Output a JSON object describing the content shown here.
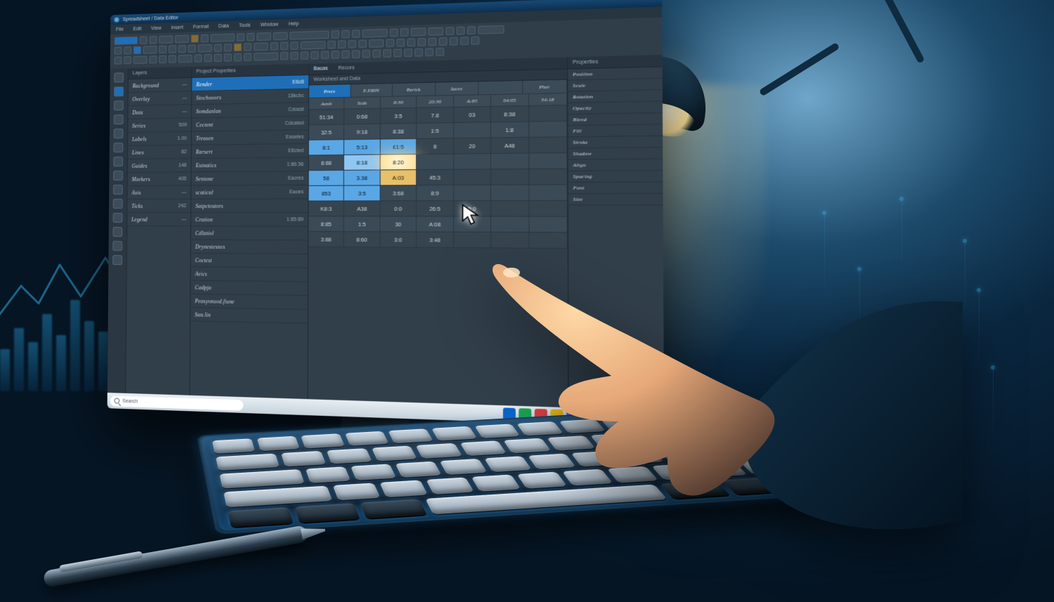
{
  "scene_description": "Stylized 3D render of a desk at night: a monitor showing a dark spreadsheet/data application, a backlit keyboard, a pen, and a desk lamp. A hand reaches toward the screen where a mouse cursor hovers over highlighted cells.",
  "app": {
    "title": "Spreadsheet / Data Editor",
    "menubar": [
      "File",
      "Edit",
      "View",
      "Insert",
      "Format",
      "Data",
      "Tools",
      "Window",
      "Help"
    ],
    "left_tool_count": 14,
    "panel_left": {
      "header": "Layers",
      "items": [
        {
          "label": "Background",
          "value": "—"
        },
        {
          "label": "Overlay",
          "value": "—"
        },
        {
          "label": "Data",
          "value": "—"
        },
        {
          "label": "Series",
          "value": "509"
        },
        {
          "label": "Labels",
          "value": "1.00"
        },
        {
          "label": "Lines",
          "value": "82"
        },
        {
          "label": "Guides",
          "value": "148"
        },
        {
          "label": "Markers",
          "value": "405"
        },
        {
          "label": "Axis",
          "value": "—"
        },
        {
          "label": "Ticks",
          "value": "242"
        },
        {
          "label": "Legend",
          "value": "—"
        }
      ]
    },
    "panel_mid": {
      "header": "Project Properties",
      "items": [
        {
          "label": "Render",
          "value": "E6c8",
          "selected": true
        },
        {
          "label": "Stochooors",
          "value": "18kcbc"
        },
        {
          "label": "Somdunlan",
          "value": "Cdosst"
        },
        {
          "label": "Cectent",
          "value": "Cdcated"
        },
        {
          "label": "Treasen",
          "value": "Easeles"
        },
        {
          "label": "Rarsert",
          "value": "E8cted"
        },
        {
          "label": "Estnatics",
          "value": "1:86.56"
        },
        {
          "label": "Sentone",
          "value": "Eacres"
        },
        {
          "label": "scatical",
          "value": "Eaoes"
        },
        {
          "label": "Satpctostors",
          "value": ""
        },
        {
          "label": "Cration",
          "value": "1:85:89"
        },
        {
          "label": "Cdlatiol",
          "value": ""
        },
        {
          "label": "Drynestesnes",
          "value": ""
        },
        {
          "label": "Coctest",
          "value": ""
        },
        {
          "label": "Aeics",
          "value": ""
        },
        {
          "label": "Cadpja",
          "value": ""
        },
        {
          "label": "Peasyonsod.fiune",
          "value": ""
        },
        {
          "label": "San.lin",
          "value": ""
        }
      ]
    },
    "panel_grid": {
      "tabs": [
        "Bacas",
        "Recors"
      ],
      "subheader": "Worksheet and Data",
      "columns": [
        "Precs",
        "E.ERIN",
        "Berick",
        "Iaces",
        "",
        "Pher"
      ],
      "subcolumns": [
        "Aonb",
        "Scds",
        "8:30",
        "20:30",
        "A:85",
        "04:05",
        "34:18"
      ],
      "rows": [
        [
          "51:34",
          "0:68",
          "3:5",
          "7.8",
          "03",
          "8:38",
          ""
        ],
        [
          "32:5",
          "9:18",
          "8:38",
          "1:5",
          "",
          "1:8",
          ""
        ],
        [
          "8:1",
          "5:13",
          "£1:5",
          "8",
          "20",
          "A48",
          ""
        ],
        [
          "8:88",
          "8:18",
          "8:20",
          "",
          "",
          "",
          ""
        ],
        [
          "58",
          "3.38",
          "A:03",
          "45:3",
          "",
          "",
          ""
        ],
        [
          "853",
          "3:5",
          "3:68",
          "8:9",
          "",
          "",
          ""
        ],
        [
          "K8:3",
          "A38",
          "0:0",
          "26:5",
          "5:0",
          "",
          ""
        ],
        [
          "8:85",
          "1:5",
          "30",
          "A:08",
          "",
          "",
          ""
        ],
        [
          "3:88",
          "8:60",
          "3:0",
          "3:48",
          "",
          "",
          ""
        ]
      ],
      "highlight": {
        "row": 3,
        "cols": [
          1,
          2
        ]
      },
      "glow_cell": {
        "row": 3,
        "col": 2
      }
    },
    "panel_right": {
      "header": "Properties",
      "items": [
        {
          "label": "Position",
          "value": ""
        },
        {
          "label": "Scale",
          "value": ""
        },
        {
          "label": "Rotation",
          "value": ""
        },
        {
          "label": "Opacity",
          "value": ""
        },
        {
          "label": "Blend",
          "value": ""
        },
        {
          "label": "Fill",
          "value": ""
        },
        {
          "label": "Stroke",
          "value": ""
        },
        {
          "label": "Shadow",
          "value": ""
        },
        {
          "label": "Align",
          "value": ""
        },
        {
          "label": "Spacing",
          "value": ""
        },
        {
          "label": "Font",
          "value": ""
        },
        {
          "label": "Size",
          "value": ""
        }
      ]
    },
    "taskbar": {
      "search_placeholder": "Search",
      "pins": [
        "#0a63c9",
        "#1aa34a",
        "#e23b3b",
        "#f2b90f",
        "#7a4de0",
        "#ff7b1a",
        "#11b5c9",
        "#c0cad3",
        "#5a6b78",
        "#2e3b46"
      ]
    }
  }
}
